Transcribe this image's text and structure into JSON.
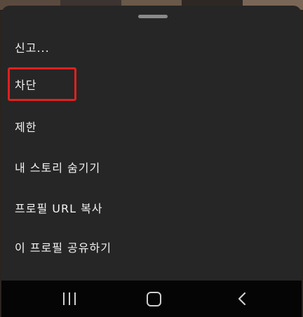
{
  "menu": {
    "items": [
      {
        "label": "신고..."
      },
      {
        "label": "차단"
      },
      {
        "label": "제한"
      },
      {
        "label": "내 스토리 숨기기"
      },
      {
        "label": "프로필 URL 복사"
      },
      {
        "label": "이 프로필 공유하기"
      }
    ]
  },
  "highlight_color": "#e02020",
  "sheet_color": "#262626",
  "navbar": {
    "recents_icon": "recents-icon",
    "home_icon": "home-icon",
    "back_icon": "back-icon"
  }
}
